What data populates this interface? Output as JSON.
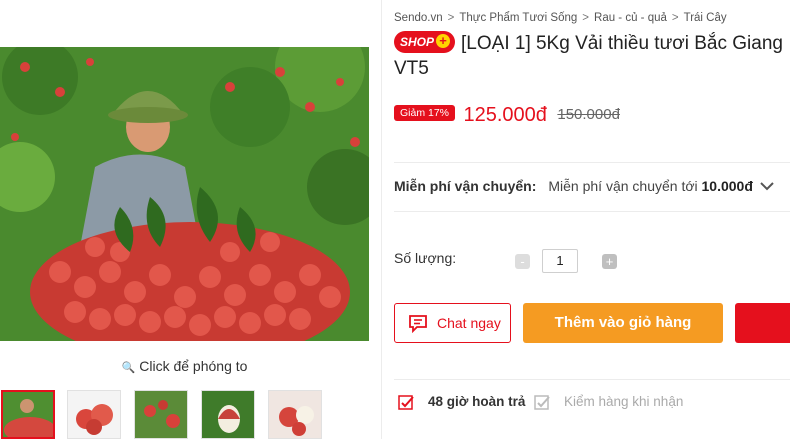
{
  "gallery": {
    "zoom_hint": "Click để phóng to",
    "thumbnails": [
      {
        "name": "thumbnail-1",
        "active": true
      },
      {
        "name": "thumbnail-2",
        "active": false
      },
      {
        "name": "thumbnail-3",
        "active": false
      },
      {
        "name": "thumbnail-4",
        "active": false
      },
      {
        "name": "thumbnail-5",
        "active": false
      }
    ]
  },
  "breadcrumb": [
    "Sendo.vn",
    "Thực Phẩm Tươi Sống",
    "Rau - củ - quả",
    "Trái Cây"
  ],
  "product": {
    "shop_badge": "SHOP",
    "title": "[LOẠI 1] 5Kg Vải thiều tươi Bắc Giang VT5",
    "discount": "Giảm 17%",
    "price": "125.000đ",
    "old_price": "150.000đ"
  },
  "shipping": {
    "label": "Miễn phí vận chuyển:",
    "value_prefix": "Miễn phí vận chuyển tới ",
    "value_amount": "10.000đ"
  },
  "quantity": {
    "label": "Số lượng:",
    "value": "1",
    "minus": "-",
    "plus": "+"
  },
  "actions": {
    "chat": "Chat ngay",
    "add_to_cart": "Thêm vào giỏ hàng"
  },
  "policies": [
    {
      "label": "48 giờ hoàn trả",
      "enabled": true
    },
    {
      "label": "Kiểm hàng khi nhận",
      "enabled": false
    }
  ],
  "colors": {
    "brand_red": "#e5101d",
    "cart_orange": "#f59b22",
    "text_dark": "#222222"
  }
}
